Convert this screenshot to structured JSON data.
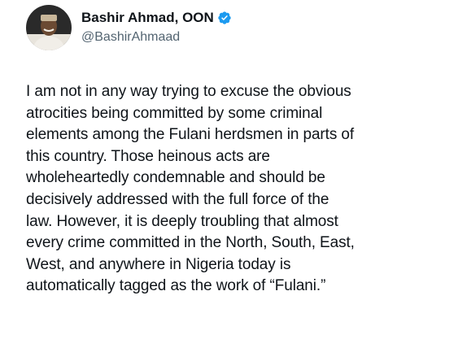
{
  "author": {
    "display_name": "Bashir Ahmad, OON",
    "handle": "@BashirAhmaad",
    "verified": true,
    "verified_color": "#1d9bf0"
  },
  "tweet": {
    "lines": [
      "I am not in any way trying to excuse the obvious",
      "atrocities being committed by some criminal",
      "elements among the Fulani herdsmen in parts of",
      "this country. Those heinous acts are",
      "wholeheartedly condemnable and should be",
      "decisively addressed with the full force of the",
      "law. However, it is deeply troubling that almost",
      "every crime committed in the North, South, East,",
      "West, and anywhere in Nigeria today is",
      "automatically tagged as the work of “Fulani.”"
    ]
  }
}
